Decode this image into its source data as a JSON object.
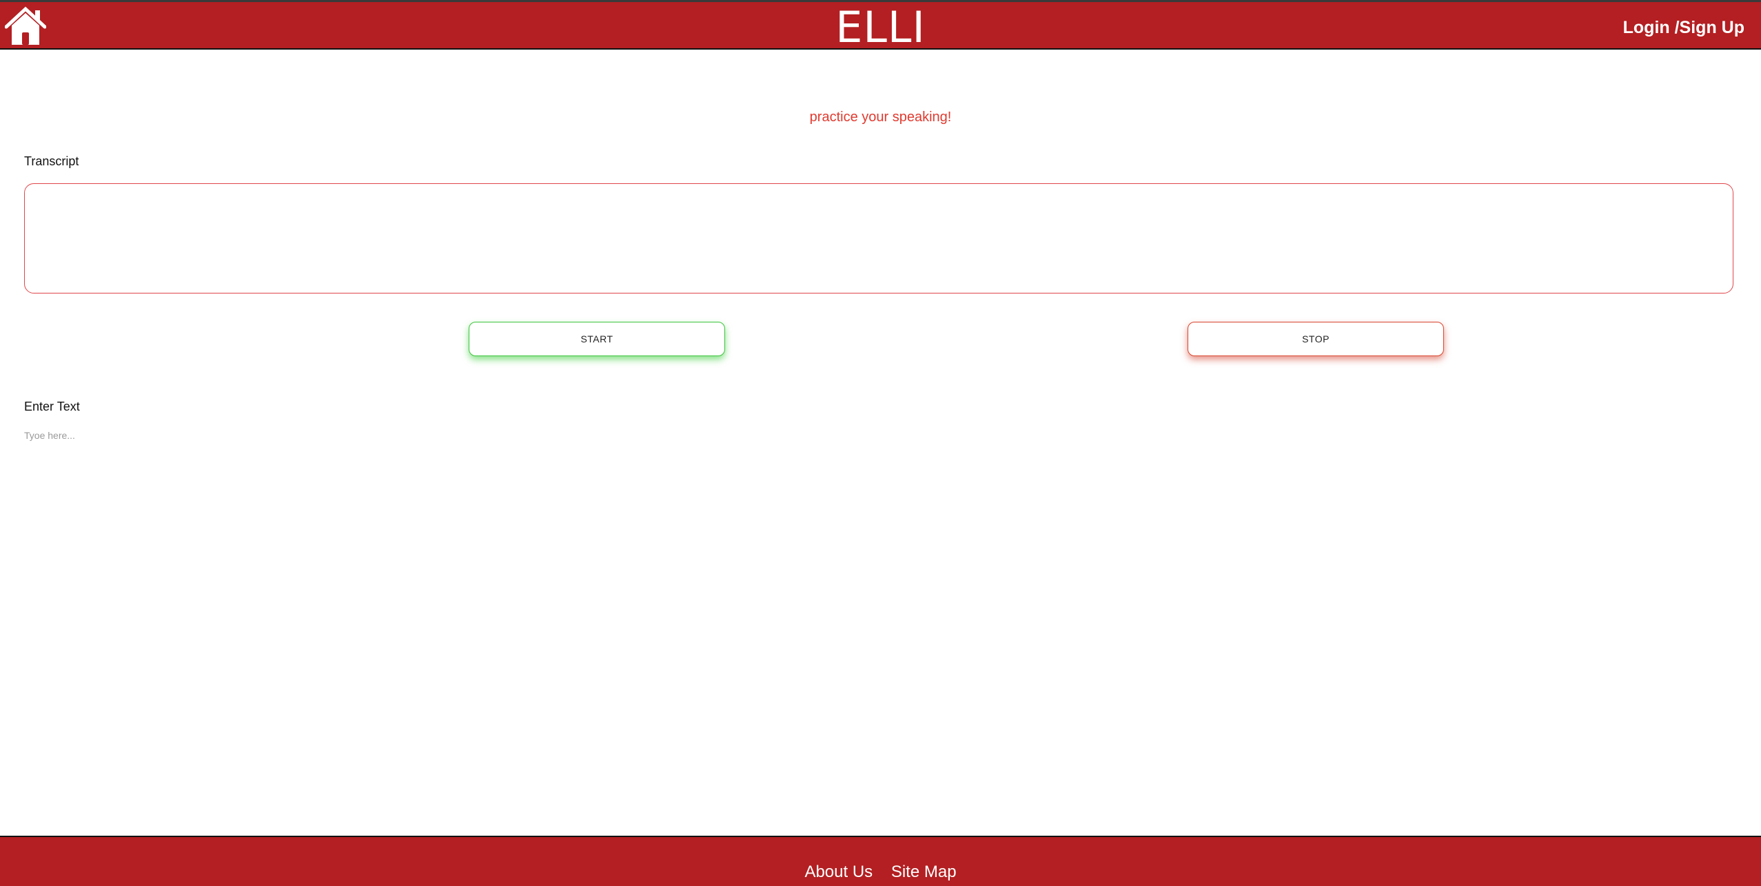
{
  "header": {
    "home_icon": "home-icon",
    "title": "ELLI",
    "login_label": "Login /Sign Up"
  },
  "main": {
    "tagline": "practice your speaking!",
    "transcript_label": "Transcript",
    "transcript_value": "",
    "start_label": "START",
    "stop_label": "STOP",
    "enter_text_label": "Enter Text",
    "enter_text_placeholder": "Tyoe here...",
    "enter_text_value": ""
  },
  "footer": {
    "links": [
      "About Us",
      "Site Map"
    ]
  },
  "colors": {
    "brand_red": "#b31f22",
    "tagline_red": "#e03a2f",
    "start_green": "#3cc43c",
    "stop_red": "#d8452e"
  }
}
